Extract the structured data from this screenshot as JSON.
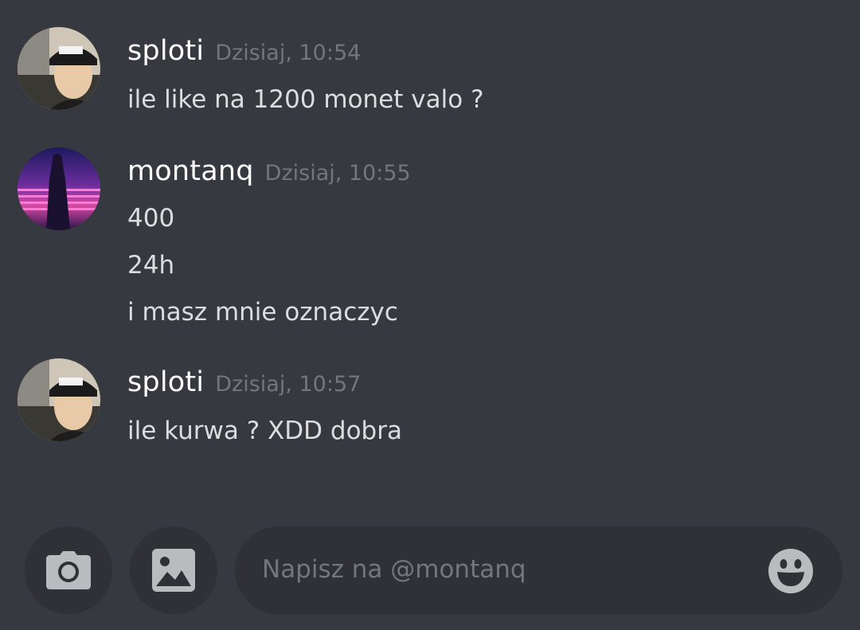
{
  "messages": [
    {
      "username": "sploti",
      "timestamp": "Dzisiaj, 10:54",
      "lines": [
        "ile like na 1200 monet valo ?"
      ]
    },
    {
      "username": "montanq",
      "timestamp": "Dzisiaj, 10:55",
      "lines": [
        "400",
        "24h",
        "i masz mnie oznaczyc"
      ]
    },
    {
      "username": "sploti",
      "timestamp": "Dzisiaj, 10:57",
      "lines": [
        "ile kurwa ? XDD dobra"
      ]
    }
  ],
  "composer": {
    "placeholder": "Napisz na @montanq",
    "camera_icon": "camera-icon",
    "image_icon": "image-icon",
    "emoji_icon": "emoji-smile-icon"
  },
  "colors": {
    "background": "#36393f",
    "input_background": "#2f3136",
    "username": "#ffffff",
    "timestamp": "#72767d",
    "message_text": "#dcddde",
    "icon": "#b9bbbe"
  }
}
